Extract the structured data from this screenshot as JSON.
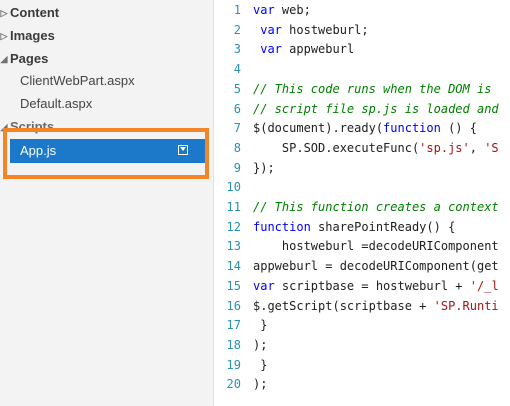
{
  "explorer": {
    "content_label": "Content",
    "images_label": "Images",
    "pages_label": "Pages",
    "page_files": [
      "ClientWebPart.aspx",
      "Default.aspx"
    ],
    "scripts_label": "Scripts",
    "selected_file": "App.js"
  },
  "editor": {
    "line_numbers": [
      "1",
      "2",
      "3",
      "4",
      "5",
      "6",
      "7",
      "8",
      "9",
      "10",
      "11",
      "12",
      "13",
      "14",
      "15",
      "16",
      "17",
      "18",
      "19",
      "20"
    ],
    "lines": [
      [
        {
          "t": "var",
          "c": "kw"
        },
        {
          "t": " web;"
        }
      ],
      [
        {
          "t": " "
        },
        {
          "t": "var",
          "c": "kw"
        },
        {
          "t": " hostweburl;"
        }
      ],
      [
        {
          "t": " "
        },
        {
          "t": "var",
          "c": "kw"
        },
        {
          "t": " appweburl"
        }
      ],
      [],
      [
        {
          "t": "// This code runs when the DOM is",
          "c": "cm"
        }
      ],
      [
        {
          "t": "// script file sp.js is loaded and",
          "c": "cm"
        }
      ],
      [
        {
          "t": "$(document).ready("
        },
        {
          "t": "function",
          "c": "kw"
        },
        {
          "t": " () {"
        }
      ],
      [
        {
          "t": "    SP.SOD.executeFunc("
        },
        {
          "t": "'sp.js'",
          "c": "str"
        },
        {
          "t": ", "
        },
        {
          "t": "'S",
          "c": "str"
        }
      ],
      [
        {
          "t": "});"
        }
      ],
      [],
      [
        {
          "t": "// This function creates a context",
          "c": "cm"
        }
      ],
      [
        {
          "t": "function",
          "c": "kw"
        },
        {
          "t": " sharePointReady() {"
        }
      ],
      [
        {
          "t": "    hostweburl =decodeURIComponent"
        }
      ],
      [
        {
          "t": "appweburl = decodeURIComponent(get"
        }
      ],
      [
        {
          "t": "var",
          "c": "kw"
        },
        {
          "t": " scriptbase = hostweburl + "
        },
        {
          "t": "'/_l",
          "c": "str"
        }
      ],
      [
        {
          "t": "$.getScript(scriptbase + "
        },
        {
          "t": "'SP.Runti",
          "c": "str"
        }
      ],
      [
        {
          "t": " }"
        }
      ],
      [
        {
          "t": ");"
        }
      ],
      [
        {
          "t": " }"
        }
      ],
      [
        {
          "t": ");"
        }
      ]
    ]
  }
}
